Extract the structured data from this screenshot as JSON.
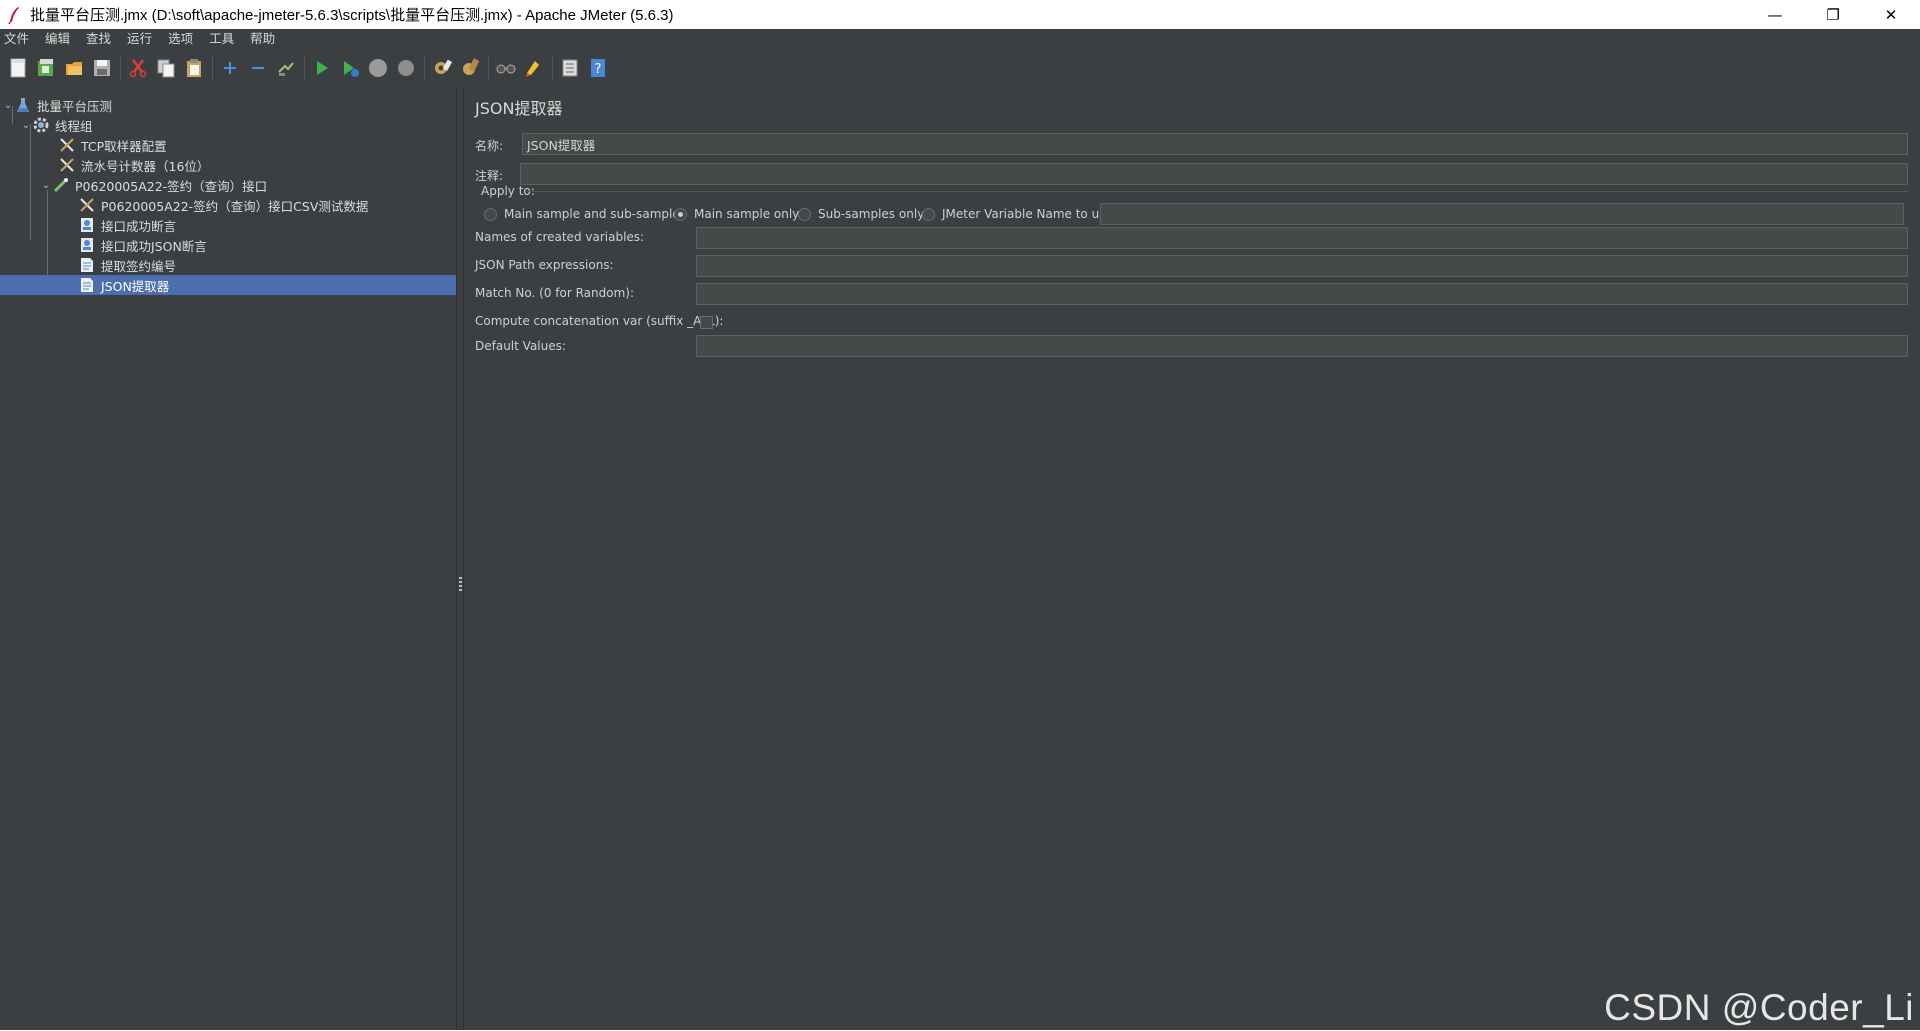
{
  "window": {
    "title": "批量平台压测.jmx (D:\\soft\\apache-jmeter-5.6.3\\scripts\\批量平台压测.jmx) - Apache JMeter (5.6.3)",
    "controls": [
      "—",
      "❐",
      "✕"
    ]
  },
  "menu": [
    "文件",
    "编辑",
    "查找",
    "运行",
    "选项",
    "工具",
    "帮助"
  ],
  "toolbar": [
    "new-icon",
    "templates-icon",
    "open-icon",
    "save-icon",
    "cut-icon",
    "copy-icon",
    "paste-icon",
    "expand-icon",
    "collapse-icon",
    "toggle-icon",
    "start-icon",
    "start-no-pause-icon",
    "stop-icon",
    "shutdown-icon",
    "clear-icon",
    "clear-all-icon",
    "search-icon",
    "reset-search-icon",
    "function-helper-icon",
    "help-icon"
  ],
  "tree": [
    {
      "label": "批量平台压测",
      "icon": "test-plan-icon",
      "indent": 0,
      "expanded": true
    },
    {
      "label": "线程组",
      "icon": "thread-group-icon",
      "indent": 1,
      "expanded": true
    },
    {
      "label": "TCP取样器配置",
      "icon": "config-element-icon",
      "indent": 2
    },
    {
      "label": "流水号计数器（16位）",
      "icon": "config-element-icon",
      "indent": 2
    },
    {
      "label": "P0620005A22-签约（查询）接口",
      "icon": "sampler-icon",
      "indent": 2,
      "expanded": true
    },
    {
      "label": "P0620005A22-签约（查询）接口CSV测试数据",
      "icon": "config-element-icon",
      "indent": 3
    },
    {
      "label": "接口成功断言",
      "icon": "assertion-icon",
      "indent": 3
    },
    {
      "label": "接口成功JSON断言",
      "icon": "assertion-icon",
      "indent": 3
    },
    {
      "label": "提取签约编号",
      "icon": "extractor-icon",
      "indent": 3
    },
    {
      "label": "JSON提取器",
      "icon": "extractor-icon",
      "indent": 3,
      "selected": true
    }
  ],
  "panel": {
    "title": "JSON提取器",
    "name_label": "名称:",
    "name_value": "JSON提取器",
    "comment_label": "注释:",
    "comment_value": "",
    "apply_to_label": "Apply to:",
    "apply_options": [
      {
        "label": "Main sample and sub-samples",
        "selected": false
      },
      {
        "label": "Main sample only",
        "selected": true
      },
      {
        "label": "Sub-samples only",
        "selected": false
      },
      {
        "label": "JMeter Variable Name to use",
        "selected": false
      }
    ],
    "variable_name_value": "",
    "fields": [
      {
        "label": "Names of created variables:",
        "value": ""
      },
      {
        "label": "JSON Path expressions:",
        "value": ""
      },
      {
        "label": "Match No. (0 for Random):",
        "value": ""
      }
    ],
    "concat_label": "Compute concatenation var (suffix _ALL):",
    "concat_checked": false,
    "default_label": "Default Values:",
    "default_value": ""
  },
  "watermark": "CSDN @Coder_Li"
}
